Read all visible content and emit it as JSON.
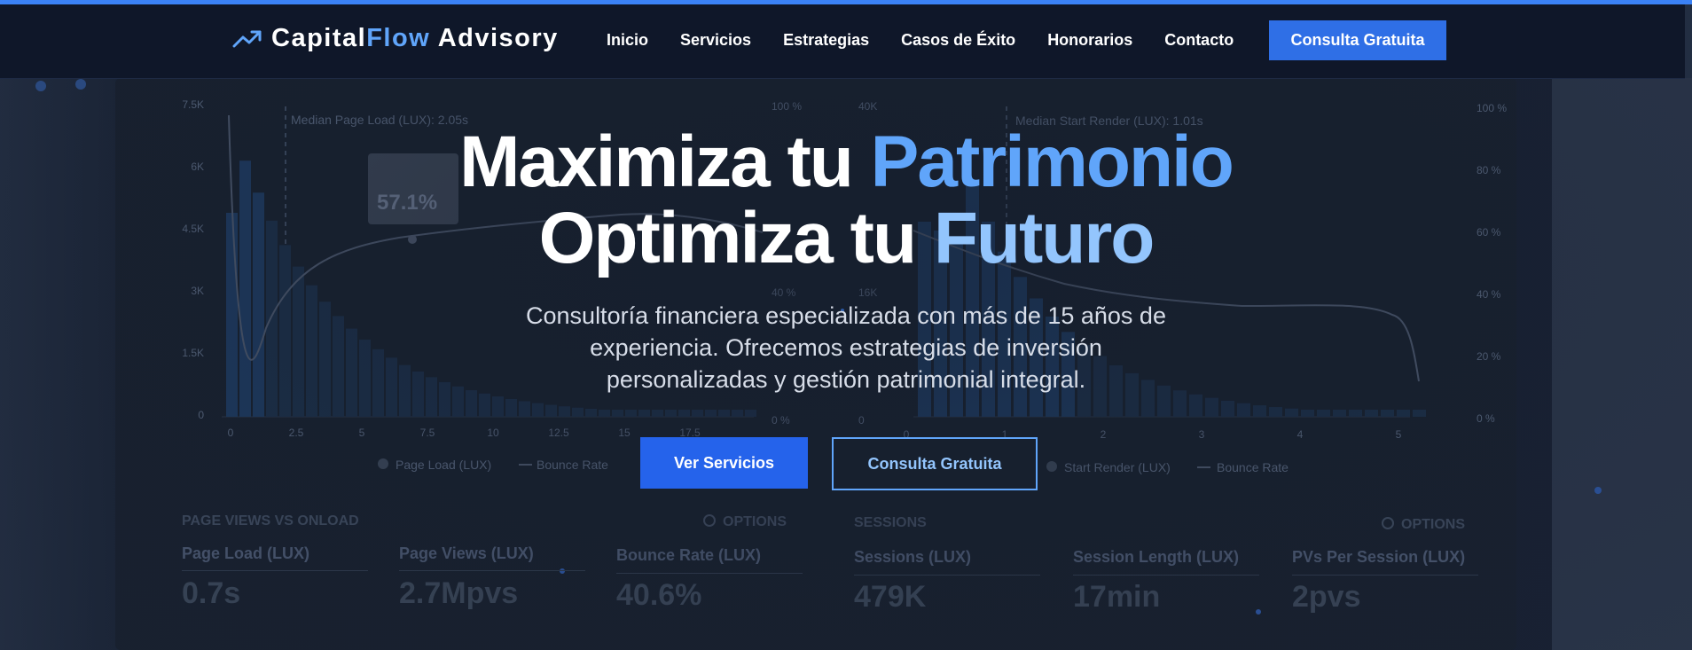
{
  "brand": {
    "name_part1": "Capital",
    "name_part2": "Flow",
    "name_part3": " Advisory",
    "icon": "trending-up-icon"
  },
  "nav": {
    "items": [
      "Inicio",
      "Servicios",
      "Estrategias",
      "Casos de Éxito",
      "Honorarios",
      "Contacto"
    ],
    "cta_label": "Consulta Gratuita"
  },
  "hero": {
    "title_line1_a": "Maximiza tu ",
    "title_line1_b": "Patrimonio",
    "title_line2_a": "Optimiza tu ",
    "title_line2_b": "Futuro",
    "subtitle": "Consultoría financiera especializada con más de 15 años de experiencia. Ofrecemos estrategias de inversión personalizadas y gestión patrimonial integral.",
    "primary_button": "Ver Servicios",
    "secondary_button": "Consulta Gratuita"
  },
  "background_dashboard": {
    "left_chart": {
      "annotation": "Median Page Load (LUX): 2.05s",
      "tooltip": "57.1%",
      "y_ticks": [
        "7.5K",
        "6K",
        "4.5K",
        "3K",
        "1.5K",
        "0"
      ],
      "x_ticks": [
        "0",
        "2.5",
        "5",
        "7.5",
        "10",
        "12.5",
        "15",
        "17.5"
      ],
      "y2_ticks": [
        "100 %",
        "40 %",
        "0 %"
      ],
      "legend": [
        "Page Load (LUX)",
        "Bounce Rate"
      ]
    },
    "right_chart": {
      "annotation": "Median Start Render (LUX): 1.01s",
      "y_ticks": [
        "40K",
        "16K",
        "0"
      ],
      "x_ticks": [
        "0",
        "1",
        "2",
        "3",
        "4",
        "5"
      ],
      "y2_ticks": [
        "100 %",
        "80 %",
        "60 %",
        "40 %",
        "20 %",
        "0 %"
      ],
      "legend": [
        "Start Render (LUX)",
        "Bounce Rate"
      ]
    },
    "section_titles": [
      "PAGE VIEWS VS ONLOAD",
      "SESSIONS"
    ],
    "options_labels": [
      "OPTIONS",
      "OPTIONS"
    ],
    "metrics": [
      {
        "label": "Page Load (LUX)",
        "value": "0.7s"
      },
      {
        "label": "Page Views (LUX)",
        "value": "2.7Mpvs"
      },
      {
        "label": "Bounce Rate (LUX)",
        "value": "40.6%"
      },
      {
        "label": "Sessions (LUX)",
        "value": "479K"
      },
      {
        "label": "Session Length (LUX)",
        "value": "17min"
      },
      {
        "label": "PVs Per Session (LUX)",
        "value": "2pvs"
      }
    ]
  },
  "colors": {
    "accent": "#3b82f6",
    "header_bg": "#0f1729",
    "highlight_blue": "#60a5fa",
    "highlight_light": "#93c5fd",
    "button_blue": "#2563eb"
  }
}
